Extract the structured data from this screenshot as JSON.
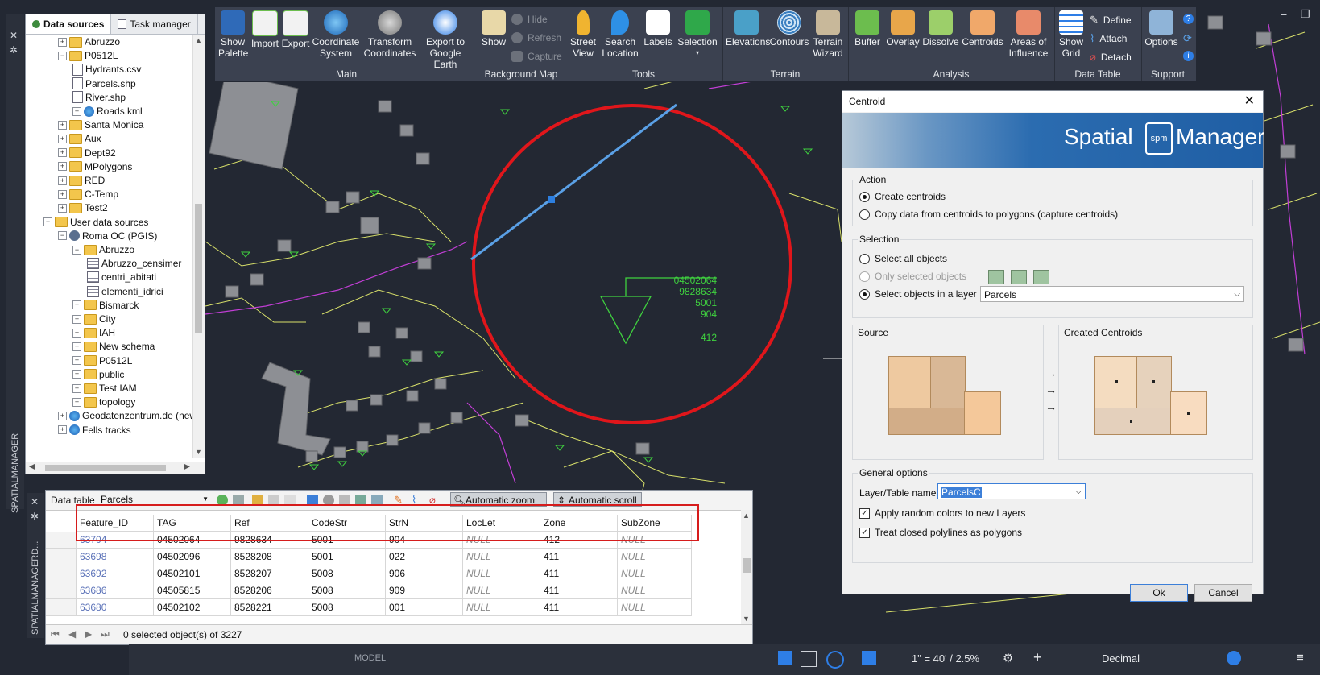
{
  "data_sources_panel": {
    "tabs": [
      "Data sources",
      "Task manager"
    ],
    "tree": [
      {
        "label": "Abruzzo",
        "kind": "folder",
        "depth": 2
      },
      {
        "label": "P0512L",
        "kind": "folder",
        "depth": 2,
        "open": true
      },
      {
        "label": "Hydrants.csv",
        "kind": "file-xyz",
        "depth": 3
      },
      {
        "label": "Parcels.shp",
        "kind": "file",
        "depth": 3
      },
      {
        "label": "River.shp",
        "kind": "file",
        "depth": 3
      },
      {
        "label": "Roads.kml",
        "kind": "globe",
        "depth": 3
      },
      {
        "label": "Santa Monica",
        "kind": "folder",
        "depth": 2
      },
      {
        "label": "Aux",
        "kind": "folder",
        "depth": 2
      },
      {
        "label": "Dept92",
        "kind": "folder",
        "depth": 2
      },
      {
        "label": "MPolygons",
        "kind": "folder",
        "depth": 2
      },
      {
        "label": "RED",
        "kind": "folder",
        "depth": 2
      },
      {
        "label": "C-Temp",
        "kind": "folder",
        "depth": 2
      },
      {
        "label": "Test2",
        "kind": "folder",
        "depth": 2
      },
      {
        "label": "User data sources",
        "kind": "user",
        "depth": 1,
        "open": true
      },
      {
        "label": "Roma OC (PGIS)",
        "kind": "db",
        "depth": 2,
        "open": true
      },
      {
        "label": "Abruzzo",
        "kind": "folder",
        "depth": 3,
        "open": true
      },
      {
        "label": "Abruzzo_censimer",
        "kind": "table",
        "depth": 4
      },
      {
        "label": "centri_abitati",
        "kind": "table",
        "depth": 4
      },
      {
        "label": "elementi_idrici",
        "kind": "table",
        "depth": 4
      },
      {
        "label": "Bismarck",
        "kind": "folder",
        "depth": 3
      },
      {
        "label": "City",
        "kind": "folder",
        "depth": 3
      },
      {
        "label": "IAH",
        "kind": "folder",
        "depth": 3
      },
      {
        "label": "New schema",
        "kind": "folder",
        "depth": 3
      },
      {
        "label": "P0512L",
        "kind": "folder",
        "depth": 3
      },
      {
        "label": "public",
        "kind": "folder",
        "depth": 3
      },
      {
        "label": "Test IAM",
        "kind": "folder",
        "depth": 3
      },
      {
        "label": "topology",
        "kind": "folder",
        "depth": 3
      },
      {
        "label": "Geodatenzentrum.de (new",
        "kind": "globe",
        "depth": 2
      },
      {
        "label": "Fells tracks",
        "kind": "globe",
        "depth": 2
      }
    ]
  },
  "side_labels": {
    "left_top": "SPATIALMANAGER",
    "left_bottom": "SPATIALMANAGERD..."
  },
  "ribbon": {
    "groups": [
      {
        "label": "Main",
        "buttons": [
          "Show\nPalette",
          "Import",
          "Export",
          "Coordinate\nSystem",
          "Transform\nCoordinates",
          "Export to\nGoogle Earth"
        ]
      },
      {
        "label": "Background Map",
        "buttons": [
          "Show"
        ],
        "small": [
          "Hide",
          "Refresh",
          "Capture"
        ]
      },
      {
        "label": "Tools",
        "buttons": [
          "Street\nView",
          "Search\nLocation",
          "Labels",
          "Selection"
        ]
      },
      {
        "label": "Terrain",
        "buttons": [
          "Elevations",
          "Contours",
          "Terrain\nWizard"
        ]
      },
      {
        "label": "Analysis",
        "buttons": [
          "Buffer",
          "Overlay",
          "Dissolve",
          "Centroids",
          "Areas of\nInfluence"
        ]
      },
      {
        "label": "Data Table",
        "buttons": [
          "Show\nGrid"
        ],
        "small": [
          "Define",
          "Attach",
          "Detach"
        ]
      },
      {
        "label": "Support",
        "buttons": [
          "Options"
        ]
      }
    ]
  },
  "map": {
    "label_lines": [
      "04502064",
      "9828634",
      "5001",
      "904",
      "412"
    ],
    "colors": {
      "bg": "#232833",
      "parcel": "#d8e06a",
      "building": "#8d8f94",
      "label": "#3fd13f",
      "circle": "#e0161b",
      "line": "#5aa0e6"
    }
  },
  "centroid_dialog": {
    "title": "Centroid",
    "brand_left": "Spatial",
    "brand_right": "Manager",
    "brand_badge": "spm",
    "action_legend": "Action",
    "action_options": [
      "Create centroids",
      "Copy data from centroids to polygons (capture centroids)"
    ],
    "selection_legend": "Selection",
    "selection_options": [
      "Select all objects",
      "Only selected objects",
      "Select objects in a layer"
    ],
    "layer_select": "Parcels",
    "source_label": "Source",
    "created_label": "Created Centroids",
    "general_legend": "General options",
    "layer_name_label": "Layer/Table name",
    "layer_name_value": "ParcelsC",
    "check_random": "Apply random colors to new Layers",
    "check_closed": "Treat closed polylines as polygons",
    "ok": "Ok",
    "cancel": "Cancel"
  },
  "data_table": {
    "label": "Data table",
    "table_select": "Parcels",
    "auto_zoom": "Automatic zoom",
    "auto_scroll": "Automatic scroll",
    "columns": [
      "Feature_ID",
      "TAG",
      "Ref",
      "CodeStr",
      "StrN",
      "LocLet",
      "Zone",
      "SubZone"
    ],
    "rows": [
      [
        "63704",
        "04502064",
        "9828634",
        "5001",
        "904",
        "NULL",
        "412",
        "NULL"
      ],
      [
        "63698",
        "04502096",
        "8528208",
        "5001",
        "022",
        "NULL",
        "411",
        "NULL"
      ],
      [
        "63692",
        "04502101",
        "8528207",
        "5008",
        "906",
        "NULL",
        "411",
        "NULL"
      ],
      [
        "63686",
        "04505815",
        "8528206",
        "5008",
        "909",
        "NULL",
        "411",
        "NULL"
      ],
      [
        "63680",
        "04502102",
        "8528221",
        "5008",
        "001",
        "NULL",
        "411",
        "NULL"
      ]
    ],
    "status": "0 selected object(s) of 3227"
  },
  "app_status": {
    "scale": "1\" = 40' / 2.5%",
    "units": "Decimal",
    "model": "MODEL"
  }
}
